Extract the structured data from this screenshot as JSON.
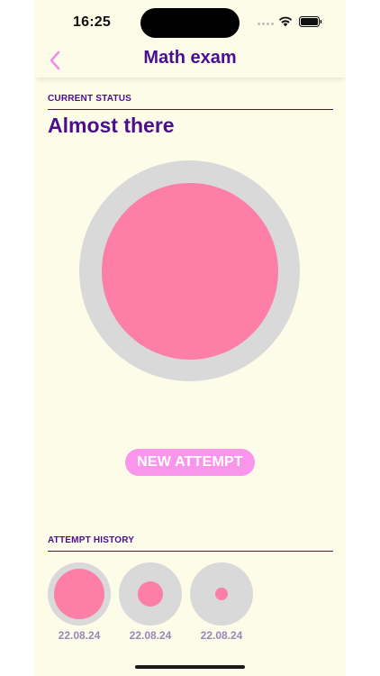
{
  "status_bar": {
    "time": "16:25"
  },
  "nav": {
    "back_icon": "chevron-left-icon",
    "title": "Math exam"
  },
  "current_status": {
    "section_label": "CURRENT STATUS",
    "title": "Almost there",
    "progress": 0.8
  },
  "actions": {
    "new_attempt_label": "NEW ATTEMPT"
  },
  "history": {
    "section_label": "ATTEMPT HISTORY",
    "attempts": [
      {
        "date": "22.08.24",
        "progress": 0.8
      },
      {
        "date": "22.08.24",
        "progress": 0.4
      },
      {
        "date": "22.08.24",
        "progress": 0.2
      }
    ]
  },
  "colors": {
    "accent": "#4a0e8f",
    "fill": "#fd7fa8",
    "track": "#d9d9d9",
    "button": "#f996ec",
    "background": "#fdfce9"
  }
}
